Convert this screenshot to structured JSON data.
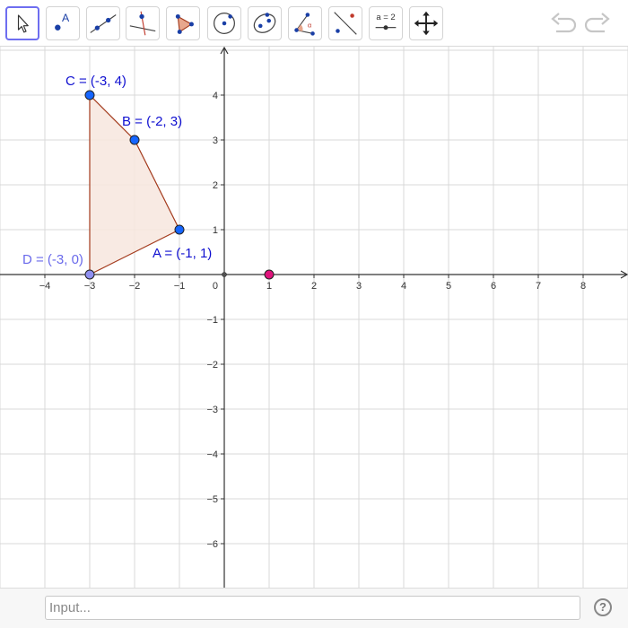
{
  "toolbar": {
    "tools": [
      {
        "name": "move-tool",
        "active": true
      },
      {
        "name": "point-tool",
        "active": false,
        "label": "A"
      },
      {
        "name": "line-tool",
        "active": false
      },
      {
        "name": "perpendicular-line-tool",
        "active": false
      },
      {
        "name": "polygon-tool",
        "active": false
      },
      {
        "name": "circle-tool",
        "active": false
      },
      {
        "name": "ellipse-tool",
        "active": false
      },
      {
        "name": "angle-tool",
        "active": false,
        "label": "α"
      },
      {
        "name": "reflect-tool",
        "active": false
      },
      {
        "name": "slider-tool",
        "active": false,
        "label": "a = 2"
      },
      {
        "name": "move-graphics-view-tool",
        "active": false
      }
    ],
    "undo_icon": "undo-icon",
    "redo_icon": "redo-icon"
  },
  "graphics": {
    "x_ticks": [
      "−4",
      "−3",
      "−2",
      "−1",
      "1",
      "2",
      "3",
      "4",
      "5",
      "6",
      "7",
      "8"
    ],
    "x_tick_values": [
      -4,
      -3,
      -2,
      -1,
      1,
      2,
      3,
      4,
      5,
      6,
      7,
      8
    ],
    "y_ticks": [
      "4",
      "3",
      "2",
      "1",
      "−1",
      "−2",
      "−3",
      "−4",
      "−5",
      "−6"
    ],
    "y_tick_values": [
      4,
      3,
      2,
      1,
      -1,
      -2,
      -3,
      -4,
      -5,
      -6
    ],
    "origin_label": "0",
    "points": [
      {
        "id": "A",
        "x": -1,
        "y": 1,
        "label": "A = (-1, 1)",
        "color": "#1565ff",
        "label_color": "#1010d0"
      },
      {
        "id": "B",
        "x": -2,
        "y": 3,
        "label": "B = (-2, 3)",
        "color": "#1565ff",
        "label_color": "#1010d0"
      },
      {
        "id": "C",
        "x": -3,
        "y": 4,
        "label": "C = (-3, 4)",
        "color": "#1565ff",
        "label_color": "#1010d0"
      },
      {
        "id": "D",
        "x": -3,
        "y": 0,
        "label": "D = (-3, 0)",
        "color": "#8f8ff0",
        "label_color": "#6a6aeb"
      },
      {
        "id": "P",
        "x": 1,
        "y": 0,
        "label": "",
        "color": "#e0147c",
        "label_color": "#e0147c"
      }
    ],
    "polygon": {
      "vertices": [
        "A",
        "B",
        "C",
        "D"
      ],
      "fill": "#f7e6de",
      "stroke": "#a33a1c"
    }
  },
  "input": {
    "placeholder": "Input..."
  },
  "help": {
    "label": "?"
  }
}
